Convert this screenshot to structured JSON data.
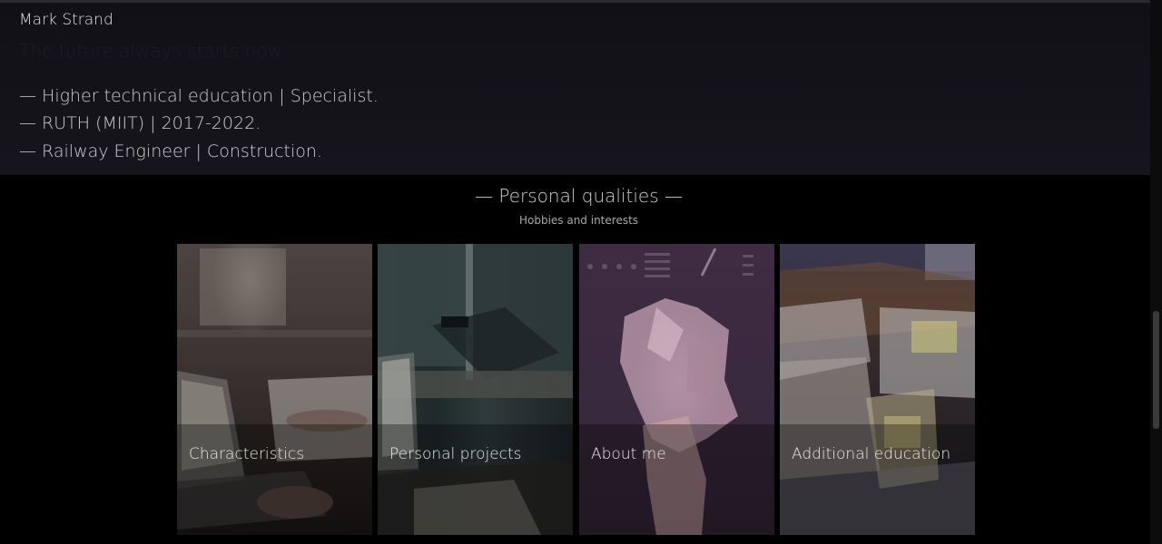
{
  "education": {
    "author": "Mark Strand",
    "quote": "The future always starts now",
    "lines": [
      "— Higher technical education | Specialist.",
      "— RUTH (MIIT) | 2017-2022.",
      "— Railway Engineer | Construction."
    ]
  },
  "qualities": {
    "title": "— Personal qualities —",
    "subtitle": "Hobbies and interests",
    "cards": [
      {
        "label": "Characteristics"
      },
      {
        "label": "Personal projects"
      },
      {
        "label": "About me"
      },
      {
        "label": "Additional education"
      }
    ]
  }
}
